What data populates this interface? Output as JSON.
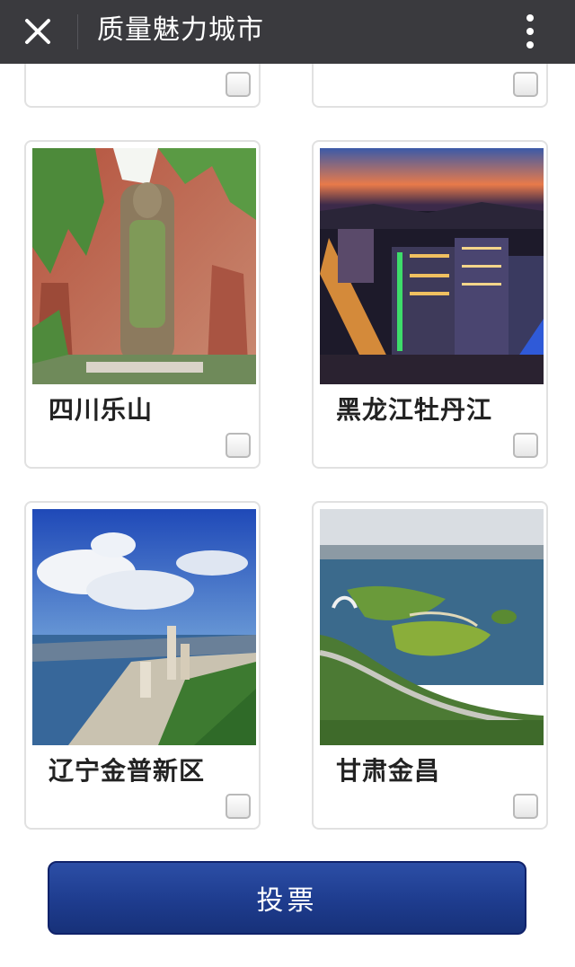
{
  "header": {
    "title": "质量魅力城市",
    "close_icon": "close-icon",
    "more_icon": "more-vertical-icon"
  },
  "cards": [
    {
      "label": "四川乐山",
      "checked": false
    },
    {
      "label": "黑龙江牡丹江",
      "checked": false
    },
    {
      "label": "辽宁金普新区",
      "checked": false
    },
    {
      "label": "甘肃金昌",
      "checked": false
    }
  ],
  "partial_cards_checked": [
    false,
    false
  ],
  "vote_button": {
    "label": "投票"
  },
  "colors": {
    "header_bg": "#3a3a3e",
    "button_bg": "#1e3c8e",
    "card_border": "#e1e1e1"
  }
}
